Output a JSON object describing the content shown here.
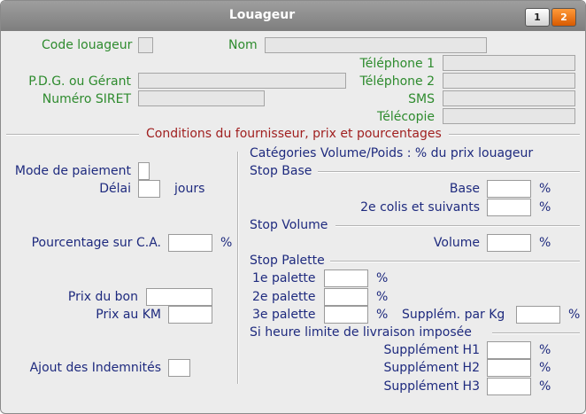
{
  "window": {
    "title": "Louageur",
    "tabs": [
      "1",
      "2"
    ]
  },
  "header_fields": {
    "code_loueur": "Code louageur",
    "nom": "Nom",
    "telephone1": "Téléphone 1",
    "pdg": "P.D.G. ou Gérant",
    "telephone2": "Téléphone 2",
    "siret": "Numéro SIRET",
    "sms": "SMS",
    "telecopie": "Télécopie"
  },
  "section_title": "Conditions du fournisseur, prix et pourcentages",
  "left": {
    "mode_paiement": "Mode de paiement",
    "delai": "Délai",
    "jours": "jours",
    "pourcentage_ca": "Pourcentage sur C.A.",
    "percent": "%",
    "prix_bon": "Prix du bon",
    "prix_km": "Prix au KM",
    "indemnites": "Ajout des Indemnités"
  },
  "right": {
    "heading": "Catégories Volume/Poids : % du prix louageur",
    "stop_base": "Stop Base",
    "base": "Base",
    "colis": "2e colis et suivants",
    "stop_volume": "Stop Volume",
    "volume": "Volume",
    "stop_palette": "Stop Palette",
    "palette1": "1e palette",
    "palette2": "2e palette",
    "palette3": "3e palette",
    "supplem_kg": "Supplém. par Kg",
    "heure_limite": "Si heure limite de livraison imposée",
    "h1": "Supplément H1",
    "h2": "Supplément H2",
    "h3": "Supplément H3",
    "percent": "%"
  }
}
